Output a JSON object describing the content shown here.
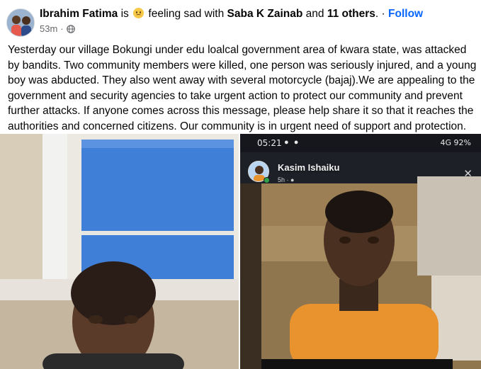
{
  "header": {
    "author": "Ibrahim Fatima",
    "is_text": "is",
    "feeling_text": "feeling sad with",
    "tagged_name": "Saba K Zainab",
    "and_text": "and",
    "others": "11 others",
    "dot": ".",
    "separator": "·",
    "follow_label": "Follow",
    "timestamp": "53m",
    "middle_dot": "·",
    "privacy_icon": "globe-icon",
    "feeling_icon": "sad-face-emoji"
  },
  "post": {
    "text": "Yesterday our village Bokungi under edu loalcal government area of kwara state, was attacked by bandits. Two community members were killed, one person was seriously injured, and a young boy was abducted. They also went away with several motorcycle (bajaj).We are appealing to the government and security agencies to take urgent action to protect our community and prevent further attacks. If anyone comes across this message, please help share it so that it reaches the authorities and concerned citizens. Our community is in urgent need of support and protection."
  },
  "photos": {
    "left": {
      "icon": "photo-selfie"
    },
    "right": {
      "status_time": "05:21",
      "status_icons": "● ●",
      "status_signal": "4G",
      "status_battery": "92%",
      "story_name": "Kasim Ishaiku",
      "story_sub": "5h · ●",
      "close": "✕"
    }
  },
  "colors": {
    "link": "#0866ff",
    "meta": "#65676b",
    "text": "#050505"
  }
}
